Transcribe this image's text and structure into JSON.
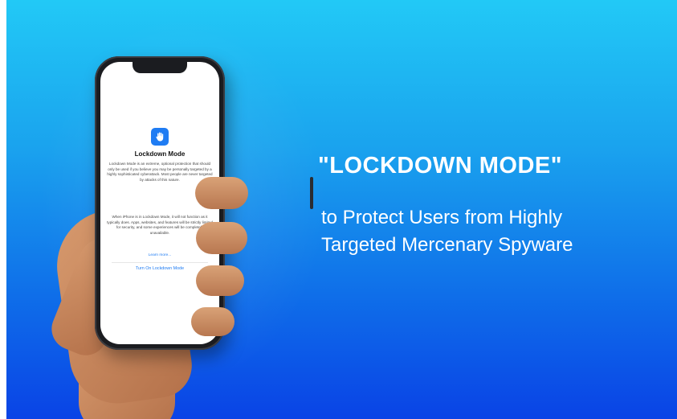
{
  "colors": {
    "background_top": "#22c9f6",
    "background_bottom": "#0a43e6",
    "accent_blue": "#1f7cf3",
    "text_white": "#ffffff"
  },
  "phone_screen": {
    "icon": "raised-hand-icon",
    "title": "Lockdown Mode",
    "paragraph_1": "Lockdown Mode is an extreme, optional protection that should only be used if you believe you may be personally targeted by a highly sophisticated cyberattack. Most people are never targeted by attacks of this nature.",
    "paragraph_2": "When iPhone is in Lockdown Mode, it will not function as it typically does. Apps, websites, and features will be strictly limited for security, and some experiences will be completely unavailable.",
    "learn_more": "Learn more...",
    "turn_on_button": "Turn On Lockdown Mode"
  },
  "headline": "\"LOCKDOWN MODE\"",
  "subheadline_line1": "to Protect Users from Highly",
  "subheadline_line2": "Targeted Mercenary Spyware"
}
